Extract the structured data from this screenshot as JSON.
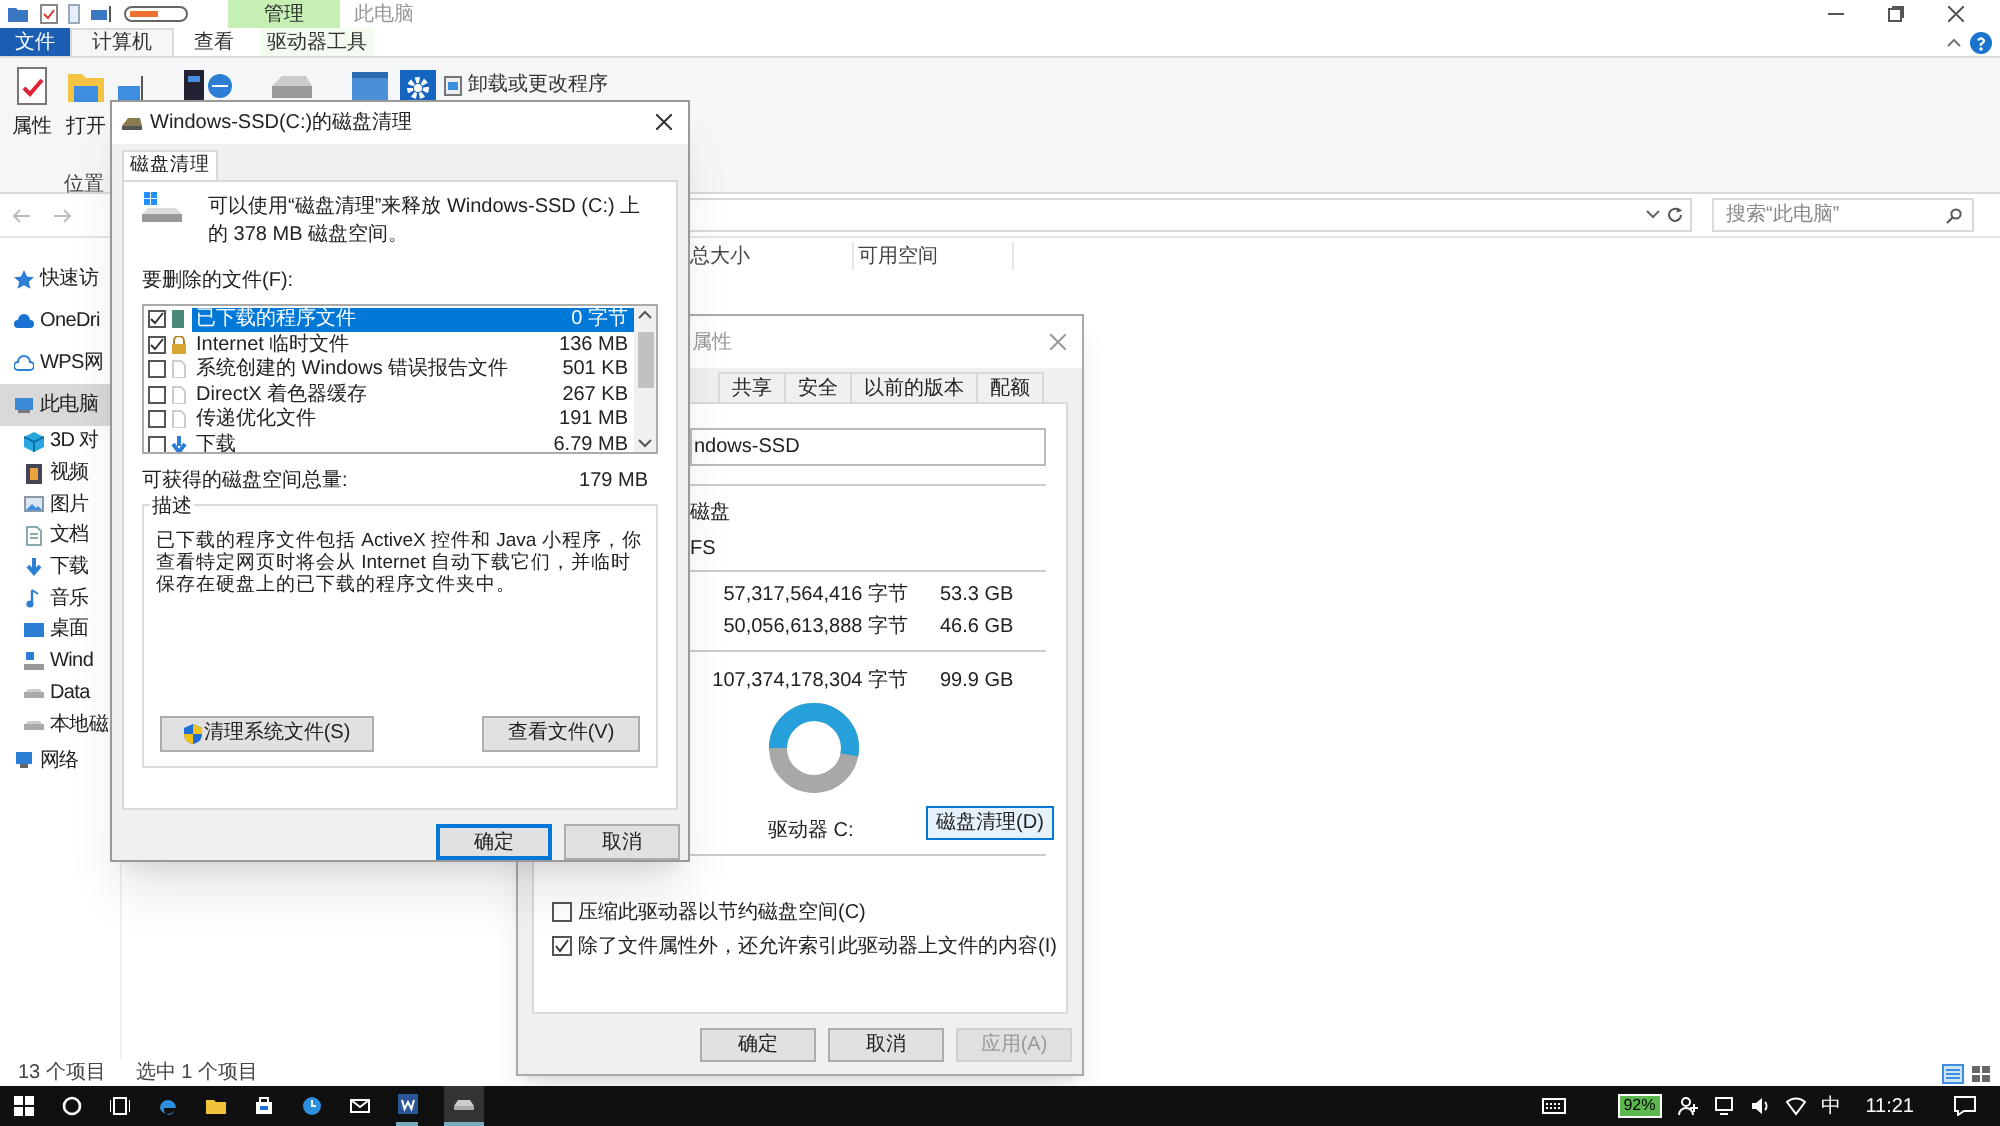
{
  "explorer": {
    "title": "此电脑",
    "context_tab": "管理",
    "menu_tabs": [
      {
        "label": "文件",
        "kind": "file",
        "selected": false
      },
      {
        "label": "计算机",
        "kind": "tab",
        "selected": true
      },
      {
        "label": "查看",
        "kind": "tab",
        "selected": false
      },
      {
        "label": "驱动器工具",
        "kind": "tool",
        "selected": false
      }
    ],
    "ribbon_buttons": [
      {
        "label": "属性",
        "kind": "properties"
      },
      {
        "label": "打开",
        "kind": "folder"
      }
    ],
    "group_label": "位置",
    "uninstall": "卸载或更改程序",
    "search": {
      "placeholder": "搜索“此电脑”"
    },
    "nav": [
      {
        "label": "快速访",
        "kind": "star",
        "selected": false
      },
      {
        "label": "OneDri",
        "kind": "cloud",
        "selected": false
      },
      {
        "label": "WPS网",
        "kind": "cloud-outline",
        "selected": false
      },
      {
        "label": "此电脑",
        "kind": "pc",
        "selected": true,
        "children": [
          {
            "label": "3D 对",
            "kind": "cube",
            "selected": false
          },
          {
            "label": "视频",
            "kind": "film",
            "selected": false
          },
          {
            "label": "图片",
            "kind": "image",
            "selected": false
          },
          {
            "label": "文档",
            "kind": "doc",
            "selected": false
          },
          {
            "label": "下载",
            "kind": "download",
            "selected": false
          },
          {
            "label": "音乐",
            "kind": "music",
            "selected": false
          },
          {
            "label": "桌面",
            "kind": "desktop",
            "selected": false
          },
          {
            "label": "Wind",
            "kind": "windrive",
            "selected": false
          },
          {
            "label": "Data",
            "kind": "drive",
            "selected": false
          },
          {
            "label": "本地磁",
            "kind": "drive",
            "selected": false
          }
        ]
      },
      {
        "label": "网络",
        "kind": "network",
        "selected": false
      }
    ],
    "columns": [
      "总大小",
      "可用空间"
    ],
    "status": [
      "13 个项目",
      "选中 1 个项目"
    ]
  },
  "properties": {
    "title": "属性",
    "tabs": [
      {
        "label": "共享",
        "selected": false
      },
      {
        "label": "安全",
        "selected": false
      },
      {
        "label": "以前的版本",
        "selected": false
      },
      {
        "label": "配额",
        "selected": false
      }
    ],
    "name_value": "ndows-SSD",
    "type_text": "磁盘",
    "fs_text": "FS",
    "rows": [
      {
        "bytes": "57,317,564,416 字节",
        "size": "53.3 GB"
      },
      {
        "bytes": "50,056,613,888 字节",
        "size": "46.6 GB"
      },
      {
        "bytes": "107,374,178,304 字节",
        "size": "99.9 GB"
      }
    ],
    "used": {
      "level": 0.53
    },
    "drive_label": "驱动器 C:",
    "cleanup_button": "磁盘清理(D)",
    "options": [
      {
        "label": "压缩此驱动器以节约磁盘空间(C)",
        "checked": false
      },
      {
        "label": "除了文件属性外，还允许索引此驱动器上文件的内容(I)",
        "checked": true
      }
    ],
    "buttons": [
      {
        "label": "确定",
        "disabled": false
      },
      {
        "label": "取消",
        "disabled": false
      },
      {
        "label": "应用(A)",
        "disabled": true
      }
    ]
  },
  "cleanup": {
    "title": "Windows-SSD(C:)的磁盘清理",
    "tab": "磁盘清理",
    "intro": "可以使用“磁盘清理”来释放 Windows-SSD (C:) 上的 378 MB 磁盘空间。",
    "files_label": "要删除的文件(F):",
    "files": [
      {
        "name": "已下载的程序文件",
        "size": "0 字节",
        "checked": true,
        "selected": true,
        "kind": "book"
      },
      {
        "name": "Internet 临时文件",
        "size": "136 MB",
        "checked": true,
        "selected": false,
        "kind": "lock"
      },
      {
        "name": "系统创建的 Windows 错误报告文件",
        "size": "501 KB",
        "checked": false,
        "selected": false,
        "kind": "page"
      },
      {
        "name": "DirectX 着色器缓存",
        "size": "267 KB",
        "checked": false,
        "selected": false,
        "kind": "page"
      },
      {
        "name": "传递优化文件",
        "size": "191 MB",
        "checked": false,
        "selected": false,
        "kind": "page"
      },
      {
        "name": "下载",
        "size": "6.79 MB",
        "checked": false,
        "selected": false,
        "kind": "download"
      }
    ],
    "total_label": "可获得的磁盘空间总量:",
    "total_value": "179 MB",
    "desc_label": "描述",
    "description": "已下载的程序文件包括 ActiveX 控件和 Java 小程序，你查看特定网页时将会从 Internet 自动下载它们，并临时保存在硬盘上的已下载的程序文件夹中。",
    "clean_system": "清理系统文件(S)",
    "view_files": "查看文件(V)",
    "buttons": [
      {
        "label": "确定",
        "default": true
      },
      {
        "label": "取消",
        "default": false
      }
    ]
  },
  "taskbar": {
    "battery": "92%",
    "ime": "中",
    "time": "11:21"
  }
}
